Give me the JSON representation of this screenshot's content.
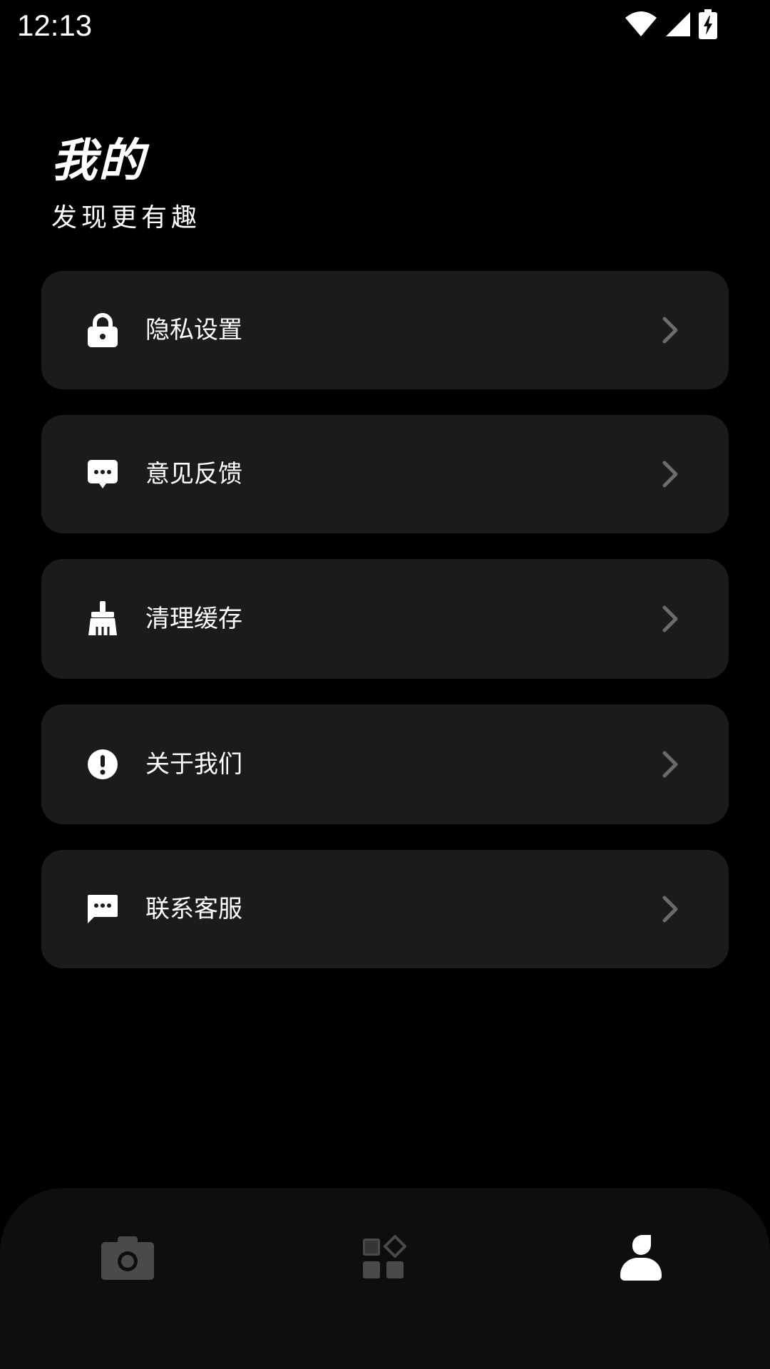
{
  "status_bar": {
    "time": "12:13",
    "icons": [
      "wifi-icon",
      "signal-icon",
      "battery-charging-icon"
    ]
  },
  "header": {
    "title": "我的",
    "subtitle": "发现更有趣"
  },
  "menu": {
    "items": [
      {
        "label": "隐私设置",
        "icon": "lock-icon"
      },
      {
        "label": "意见反馈",
        "icon": "feedback-icon"
      },
      {
        "label": "清理缓存",
        "icon": "broom-icon"
      },
      {
        "label": "关于我们",
        "icon": "info-icon"
      },
      {
        "label": "联系客服",
        "icon": "chat-icon"
      }
    ]
  },
  "bottom_nav": {
    "tabs": [
      {
        "icon": "camera-icon",
        "active": false
      },
      {
        "icon": "apps-icon",
        "active": false
      },
      {
        "icon": "profile-icon",
        "active": true
      }
    ]
  },
  "colors": {
    "background": "#000000",
    "card": "#1b1b1b",
    "nav_background": "#0e0e0e",
    "inactive_icon": "#4a4a4a",
    "active_icon": "#ffffff",
    "chevron": "#6b6b6b"
  }
}
